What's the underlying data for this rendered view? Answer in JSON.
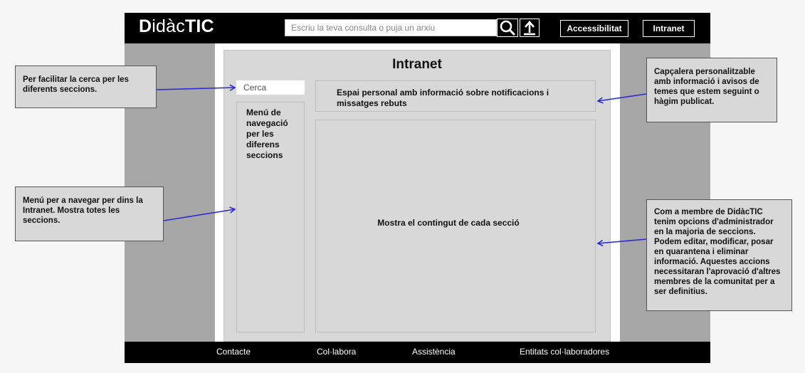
{
  "header": {
    "logo_part1": "D",
    "logo_part2": "idàc",
    "logo_part3": "TIC",
    "search_placeholder": "Escriu la teva consulta o puja un arxiu",
    "search_icon": "search-icon",
    "upload_icon": "upload-icon",
    "accessibility_label": "Accessibilitat",
    "intranet_label": "Intranet"
  },
  "main": {
    "title": "Intranet",
    "search_label": "Cerca",
    "nav_menu_label": "Menú de navegació per les diferens seccions",
    "header_text": "Espai personal amb informació sobre notificacions i missatges rebuts",
    "content_text": "Mostra el contingut de cada secció"
  },
  "footer": {
    "links": [
      "Contacte",
      "Col·labora",
      "Assistència",
      "Entitats col·laboradores"
    ]
  },
  "annotations": {
    "search_note": "Per facilitar la cerca per les diferents seccions.",
    "menu_note": "Menú per a navegar per dins la Intranet. Mostra totes les seccions.",
    "header_note": "Capçalera personalitzable amb informació i avisos de temes que estem seguint o hàgim publicat.",
    "admin_note": "Com a membre de DidàcTIC tenim opcions d'administrador en la majoria de seccions. Podem editar, modificar, posar en  quarantena i eliminar informació. Aquestes accions necessitaran l'aprovació d'altres membres de la comunitat per a ser definitius."
  },
  "colors": {
    "header_bg": "#000000",
    "side_gray": "#a6a6a6",
    "panel_gray": "#d8d8d8",
    "arrow": "#2b2bd6"
  }
}
